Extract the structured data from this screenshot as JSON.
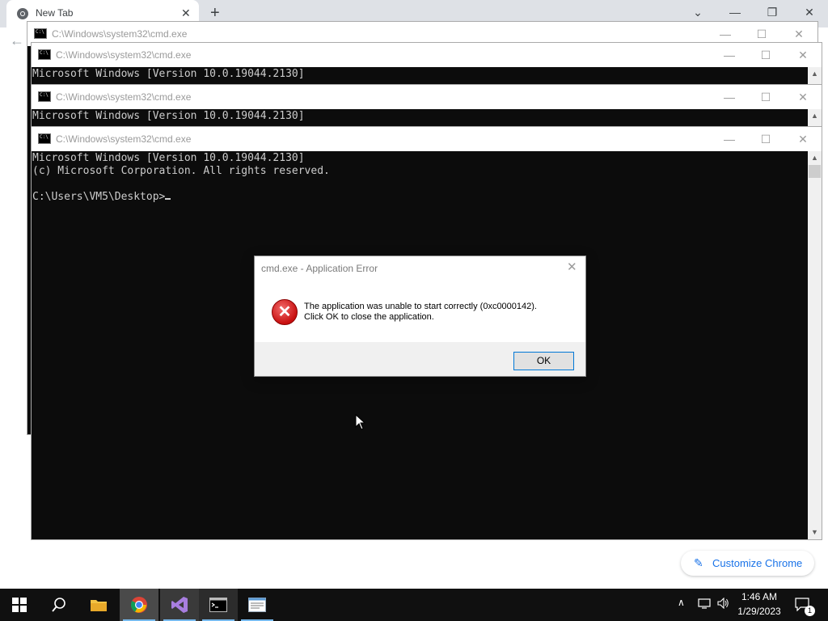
{
  "chrome": {
    "tab_title": "New Tab",
    "close_glyph": "✕",
    "newtab_glyph": "+",
    "tabsearch_glyph": "⌄",
    "minimize_glyph": "—",
    "restore_glyph": "❐",
    "window_close_glyph": "✕",
    "back_glyph": "←",
    "customize_label": "Customize Chrome",
    "accent": "#1a73e8"
  },
  "cmd_windows": [
    {
      "title": "C:\\Windows\\system32\\cmd.exe",
      "lines": []
    },
    {
      "title": "C:\\Windows\\system32\\cmd.exe",
      "lines": [
        "Microsoft Windows [Version 10.0.19044.2130]"
      ]
    },
    {
      "title": "C:\\Windows\\system32\\cmd.exe",
      "lines": [
        "Microsoft Windows [Version 10.0.19044.2130]"
      ]
    },
    {
      "title": "C:\\Windows\\system32\\cmd.exe",
      "lines": [
        "Microsoft Windows [Version 10.0.19044.2130]",
        "(c) Microsoft Corporation. All rights reserved.",
        "",
        "C:\\Users\\VM5\\Desktop>"
      ]
    }
  ],
  "cmd_buttons": {
    "minimize": "—",
    "maximize": "☐",
    "close": "✕",
    "scroll_up": "▲",
    "scroll_down": "▼"
  },
  "dialog": {
    "title": "cmd.exe - Application Error",
    "close_glyph": "✕",
    "message_line1": "The application was unable to start correctly (0xc0000142).",
    "message_line2": "Click OK to close the application.",
    "ok_label": "OK",
    "icon": "error-x-icon"
  },
  "taskbar": {
    "items": [
      "windows-start-icon",
      "search-icon",
      "file-explorer-icon",
      "chrome-icon",
      "visual-studio-icon",
      "cmd-icon",
      "notepad-icon"
    ],
    "tray_arrow": "∧",
    "time": "1:46 AM",
    "date": "1/29/2023",
    "notification_count": "1"
  }
}
